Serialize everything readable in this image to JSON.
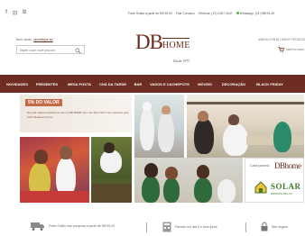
{
  "topbar": {
    "social": [
      "f",
      "⊡",
      "B"
    ],
    "free_shipping": "Frete Grátis a partir de R$ 99,00",
    "contact": "Fale Conosco",
    "phone": "Telefone: (21) 2287-3447",
    "whatsapp": "Whatsapp: (21) 98076-45"
  },
  "header": {
    "welcome_prefix": "Bem-vindo,",
    "welcome_link": "identifique-se",
    "search_placeholder": "Digite o que você procura",
    "logo_db": "DB",
    "logo_home": "HOME",
    "logo_since": "Desde 1973",
    "account": "MINHA CONTA | MEUS PEDIDOS",
    "cart": "carrinho vazio"
  },
  "nav": {
    "items": [
      "NOVIDADES",
      "PRESENTES",
      "MESA POSTA",
      "CHÁ DA TARDE",
      "BAR",
      "VASOS E CACHEPOTS",
      "MÓVEIS",
      "DECORAÇÃO",
      "BLACK FRIDAY"
    ]
  },
  "promo": {
    "badge": "5% DO VALOR",
    "text": "De toda compra realizada no site da DB HOME até o dia 28/12/2017 será revertido pelo Solar Meninos de Luz."
  },
  "solar": {
    "prefix": "Cada parceria",
    "db": "DBhome",
    "name": "SOLAR",
    "sub": "MENINOS DE LUZ"
  },
  "footer": {
    "free_shipping": "Frete Grátis nas compras a partir de R$ 99,00",
    "installments": "Parcele em até 5 x sem juros",
    "secure": "Site seguro"
  },
  "colors": {
    "brand": "#6b2a1c",
    "nav_bg": "#6e2d22",
    "solar_green": "#3f7a2c"
  }
}
